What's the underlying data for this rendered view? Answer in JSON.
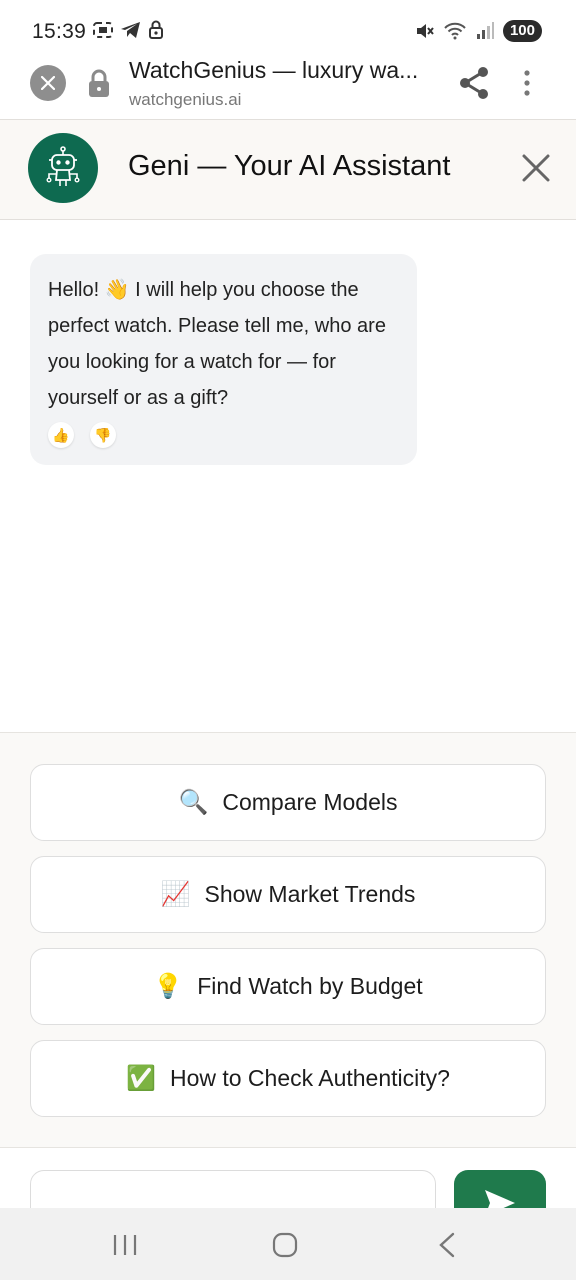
{
  "status_bar": {
    "time": "15:39",
    "battery": "100",
    "icons": [
      "screenshot-icon",
      "telegram-icon",
      "lock-icon",
      "mute-icon",
      "wifi-icon",
      "signal-icon"
    ]
  },
  "browser": {
    "title": "WatchGenius — luxury wa...",
    "url": "watchgenius.ai"
  },
  "chat": {
    "assistant_name": "Geni — Your AI Assistant",
    "brand_color": "#0e6a50",
    "messages": [
      {
        "sender": "assistant",
        "text": "Hello! 👋 I will help you choose the perfect watch. Please tell me, who are you looking for a watch for — for yourself or as a gift?",
        "feedback": [
          "👍",
          "👎"
        ]
      }
    ]
  },
  "suggestions": [
    {
      "emoji": "🔍",
      "label": "Compare Models"
    },
    {
      "emoji": "📈",
      "label": "Show Market Trends"
    },
    {
      "emoji": "💡",
      "label": "Find Watch by Budget"
    },
    {
      "emoji": "✅",
      "label": "How to Check Authenticity?"
    }
  ],
  "composer": {
    "send_color": "#1f7a4c"
  },
  "nav": {
    "icons": [
      "recents-icon",
      "home-icon",
      "back-icon"
    ]
  }
}
